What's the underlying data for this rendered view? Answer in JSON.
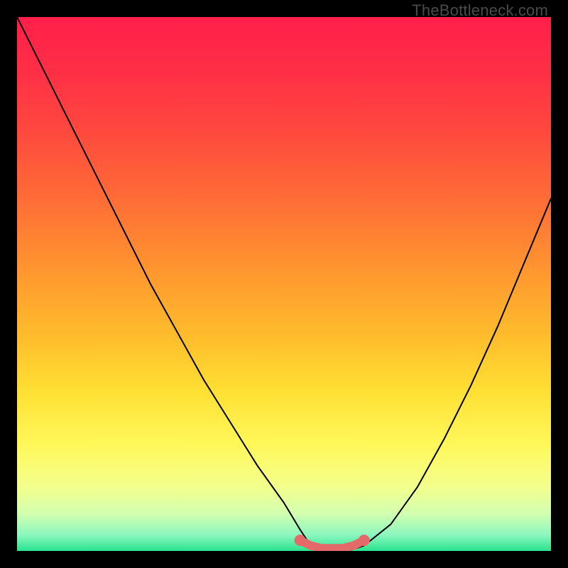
{
  "watermark": "TheBottleneck.com",
  "chart_data": {
    "type": "line",
    "title": "",
    "xlabel": "",
    "ylabel": "",
    "xlim": [
      0,
      100
    ],
    "ylim": [
      0,
      100
    ],
    "grid": false,
    "legend": false,
    "series": [
      {
        "name": "curve",
        "x": [
          0,
          5,
          10,
          15,
          20,
          25,
          30,
          35,
          40,
          45,
          50,
          53,
          55,
          58,
          60,
          62,
          65,
          70,
          75,
          80,
          85,
          90,
          95,
          100
        ],
        "y": [
          100,
          90,
          80,
          70,
          60,
          50,
          41,
          32,
          24,
          16,
          9,
          4,
          1,
          0,
          0,
          0,
          1,
          5,
          12,
          21,
          31,
          42,
          54,
          66
        ]
      }
    ],
    "highlight": {
      "name": "flat-bottom",
      "x": [
        53,
        55,
        57,
        59,
        61,
        63,
        65
      ],
      "y": [
        2,
        1,
        0.5,
        0.5,
        0.5,
        1,
        2
      ],
      "color": "#e46a6a"
    },
    "gradient_stops": [
      {
        "offset": 0.0,
        "color": "#ff1f4a"
      },
      {
        "offset": 0.1,
        "color": "#ff2e46"
      },
      {
        "offset": 0.22,
        "color": "#ff4a3e"
      },
      {
        "offset": 0.35,
        "color": "#ff6f36"
      },
      {
        "offset": 0.48,
        "color": "#ff982f"
      },
      {
        "offset": 0.6,
        "color": "#ffbd2c"
      },
      {
        "offset": 0.7,
        "color": "#ffdf33"
      },
      {
        "offset": 0.8,
        "color": "#fff85a"
      },
      {
        "offset": 0.88,
        "color": "#f3ff8c"
      },
      {
        "offset": 0.93,
        "color": "#d2ffb0"
      },
      {
        "offset": 0.97,
        "color": "#8cf7be"
      },
      {
        "offset": 1.0,
        "color": "#29e38f"
      }
    ]
  }
}
